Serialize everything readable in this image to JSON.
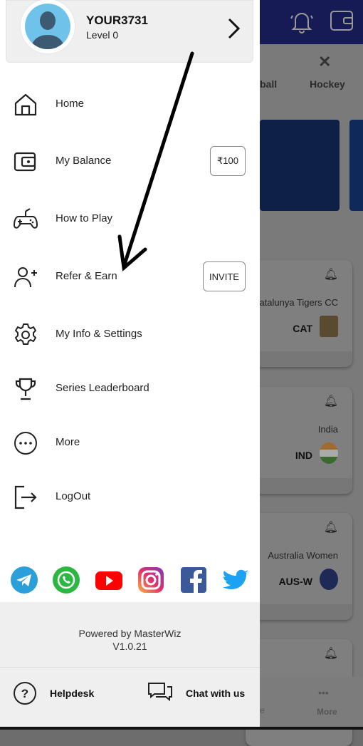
{
  "profile": {
    "username": "YOUR3731",
    "level": "Level 0"
  },
  "menu": [
    {
      "label": "Home",
      "icon": "home-icon"
    },
    {
      "label": "My Balance",
      "icon": "wallet-icon",
      "badge": "₹100"
    },
    {
      "label": "How to Play",
      "icon": "gamepad-icon"
    },
    {
      "label": "Refer & Earn",
      "icon": "add-user-icon",
      "badge": "INVITE"
    },
    {
      "label": "My Info & Settings",
      "icon": "gear-icon"
    },
    {
      "label": "Series Leaderboard",
      "icon": "trophy-icon"
    },
    {
      "label": "More",
      "icon": "more-icon"
    },
    {
      "label": "LogOut",
      "icon": "logout-icon"
    }
  ],
  "social": [
    "telegram",
    "whatsapp",
    "youtube",
    "instagram",
    "facebook",
    "twitter"
  ],
  "footer": {
    "powered": "Powered by MasterWiz",
    "version": "V1.0.21",
    "helpdesk": "Helpdesk",
    "chat": "Chat with us"
  },
  "background": {
    "sports": [
      "ball",
      "Hockey"
    ],
    "matches": [
      {
        "team": "atalunya Tigers CC",
        "abbr": "CAT"
      },
      {
        "team": "India",
        "abbr": "IND"
      },
      {
        "team": "Australia Women",
        "abbr": "AUS-W"
      }
    ],
    "bottom_nav": {
      "partial": "e",
      "more": "More"
    }
  },
  "colors": {
    "header": "#171b55",
    "drawer": "#ffffff",
    "overlay": "#7a7a7a"
  }
}
